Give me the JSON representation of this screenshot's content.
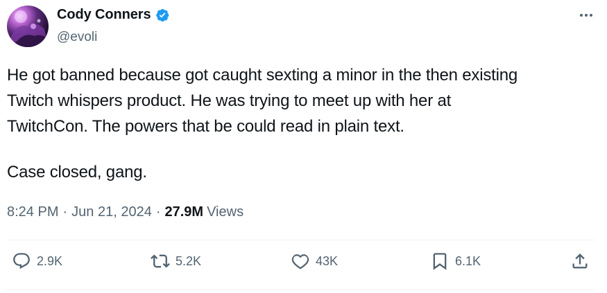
{
  "author": {
    "display_name": "Cody Conners",
    "handle": "@evoli",
    "verified": true
  },
  "tweet": {
    "paragraph_1": "He got banned because got caught sexting a minor in the then existing\nTwitch whispers product. He was trying to meet up with her at\nTwitchCon. The powers that be could read in plain text.",
    "paragraph_2": "Case closed, gang.",
    "time": "8:24 PM",
    "separator": "·",
    "date": "Jun 21, 2024",
    "views_count": "27.9M",
    "views_label": "Views"
  },
  "actions": {
    "replies": "2.9K",
    "reposts": "5.2K",
    "likes": "43K",
    "bookmarks": "6.1K"
  },
  "icons": {
    "verified": "verified-badge-icon",
    "more": "more-horizontal-icon",
    "reply": "reply-bubble-icon",
    "repost": "repost-arrows-icon",
    "like": "heart-icon",
    "bookmark": "bookmark-icon",
    "share": "share-upload-icon"
  },
  "colors": {
    "text_primary": "#0f1419",
    "text_secondary": "#536471",
    "verified_blue": "#1d9bf0",
    "divider": "#eff3f4"
  }
}
